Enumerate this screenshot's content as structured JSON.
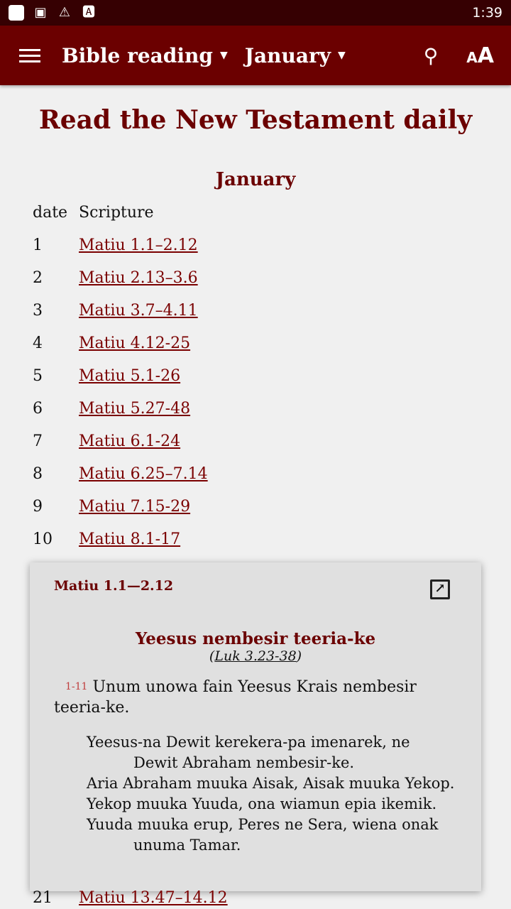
{
  "status": {
    "time": "1:39",
    "icons": [
      "notification-icon",
      "image-icon",
      "warning-icon",
      "font-icon"
    ]
  },
  "toolbar": {
    "book": "Bible reading",
    "month": "January",
    "search_icon": "search-icon",
    "text_size_icon": "text-size-icon"
  },
  "page": {
    "title": "Read the New Testament daily",
    "month_heading": "January",
    "col_date": "date",
    "col_scripture": "Scripture",
    "rows": [
      {
        "d": "1",
        "s": "Matiu 1.1–2.12"
      },
      {
        "d": "2",
        "s": "Matiu 2.13–3.6"
      },
      {
        "d": "3",
        "s": "Matiu 3.7–4.11"
      },
      {
        "d": "4",
        "s": "Matiu 4.12-25"
      },
      {
        "d": "5",
        "s": "Matiu 5.1-26"
      },
      {
        "d": "6",
        "s": "Matiu 5.27-48"
      },
      {
        "d": "7",
        "s": "Matiu 6.1-24"
      },
      {
        "d": "8",
        "s": "Matiu 6.25–7.14"
      },
      {
        "d": "9",
        "s": "Matiu 7.15-29"
      },
      {
        "d": "10",
        "s": "Matiu 8.1-17"
      }
    ],
    "row21": {
      "d": "21",
      "s": "Matiu 13.47–14.12"
    }
  },
  "popup": {
    "title": "Matiu 1.1—2.12",
    "section": "Yeesus nembesir teeria-ke",
    "xref_open": "(",
    "xref": "Luk 3.23-38",
    "xref_close": ")",
    "verse": "1-11",
    "para": "Unum unowa fain Yeesus Krais nembesir teeria-ke.",
    "poem": [
      "Yeesus-na Dewit kerekera-pa imenarek, ne Dewit Abraham nembesir-ke.",
      "Aria Abraham muuka Aisak, Aisak muuka Yekop.",
      "Yekop muuka Yuuda, ona wiamun epia ikemik.",
      "Yuuda muuka erup, Peres ne Sera, wiena onak unuma Tamar."
    ]
  }
}
